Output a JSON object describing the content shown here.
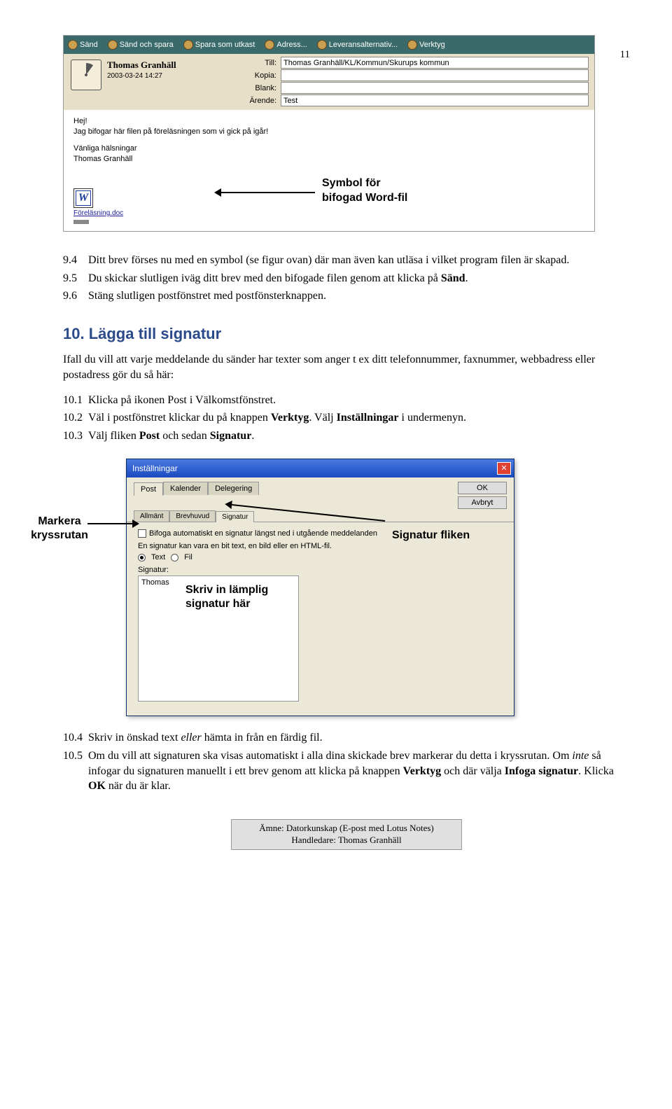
{
  "page_number": "11",
  "email": {
    "toolbar": [
      "Sänd",
      "Sänd och spara",
      "Spara som utkast",
      "Adress...",
      "Leveransalternativ...",
      "Verktyg"
    ],
    "sender_name": "Thomas Granhäll",
    "sender_date": "2003-03-24 14:27",
    "fields": {
      "till_label": "Till:",
      "till_value": "Thomas Granhäll/KL/Kommun/Skurups kommun",
      "kopia_label": "Kopia:",
      "kopia_value": "",
      "blank_label": "Blank:",
      "blank_value": "",
      "arende_label": "Ärende:",
      "arende_value": "Test"
    },
    "body": {
      "l1": "Hej!",
      "l2": "Jag bifogar här filen på föreläsningen som vi gick på igår!",
      "l3": "Vänliga hälsningar",
      "l4": "Thomas Granhäll"
    },
    "attach_name": "Föreläsning.doc",
    "callout_l1": "Symbol för",
    "callout_l2": "bifogad Word-fil"
  },
  "doc": {
    "p_9_4": "9.4",
    "t_9_4": "Ditt brev förses nu med en symbol (se figur ovan) där man även kan utläsa i vilket program filen är skapad.",
    "p_9_5": "9.5",
    "t_9_5_a": "Du skickar slutligen iväg ditt brev med den bifogade filen genom att klicka på ",
    "t_9_5_b": "Sänd",
    "t_9_5_c": ".",
    "p_9_6": "9.6",
    "t_9_6": "Stäng slutligen postfönstret med postfönsterknappen.",
    "h2_10": "10. Lägga till signatur",
    "intro_10": "Ifall du vill att varje meddelande du sänder har texter som anger t ex ditt telefonnummer, faxnummer, webbadress eller postadress gör du så här:",
    "p_10_1": "10.1",
    "t_10_1": "Klicka på ikonen Post i Välkomstfönstret.",
    "p_10_2": "10.2",
    "t_10_2_a": "Väl i postfönstret klickar du på knappen ",
    "t_10_2_b": "Verktyg",
    "t_10_2_c": ". Välj ",
    "t_10_2_d": "Inställningar",
    "t_10_2_e": " i undermenyn.",
    "p_10_3": "10.3",
    "t_10_3_a": "Välj fliken ",
    "t_10_3_b": "Post",
    "t_10_3_c": " och sedan ",
    "t_10_3_d": "Signatur",
    "t_10_3_e": ".",
    "p_10_4": "10.4",
    "t_10_4_a": "Skriv in önskad text ",
    "t_10_4_b": "eller",
    "t_10_4_c": " hämta in från en färdig fil.",
    "p_10_5": "10.5",
    "t_10_5_a": "Om du vill att signaturen ska visas automatiskt i alla dina skickade brev markerar du detta i kryssrutan. Om ",
    "t_10_5_b": "inte",
    "t_10_5_c": " så infogar du signaturen manuellt i ett brev genom att klicka på knappen ",
    "t_10_5_d": "Verktyg",
    "t_10_5_e": " och där välja ",
    "t_10_5_f": "Infoga signatur",
    "t_10_5_g": ". Klicka ",
    "t_10_5_h": "OK",
    "t_10_5_i": " när du är klar."
  },
  "dialog": {
    "title": "Inställningar",
    "ok": "OK",
    "cancel": "Avbryt",
    "tabs_outer": [
      "Post",
      "Kalender",
      "Delegering"
    ],
    "tabs_inner": [
      "Allmänt",
      "Brevhuvud",
      "Signatur"
    ],
    "chk_label": "Bifoga automatiskt en signatur längst ned i utgående meddelanden",
    "desc": "En signatur kan vara en bit text, en bild eller en HTML-fil.",
    "radio_text": "Text",
    "radio_fil": "Fil",
    "sig_label": "Signatur:",
    "sig_value": "Thomas"
  },
  "ann": {
    "markera_l1": "Markera",
    "markera_l2": "kryssrutan",
    "sigflik": "Signatur fliken",
    "skriv_l1": "Skriv in lämplig",
    "skriv_l2": "signatur här"
  },
  "footer": {
    "l1": "Ämne: Datorkunskap (E-post med Lotus Notes)",
    "l2": "Handledare: Thomas Granhäll"
  }
}
